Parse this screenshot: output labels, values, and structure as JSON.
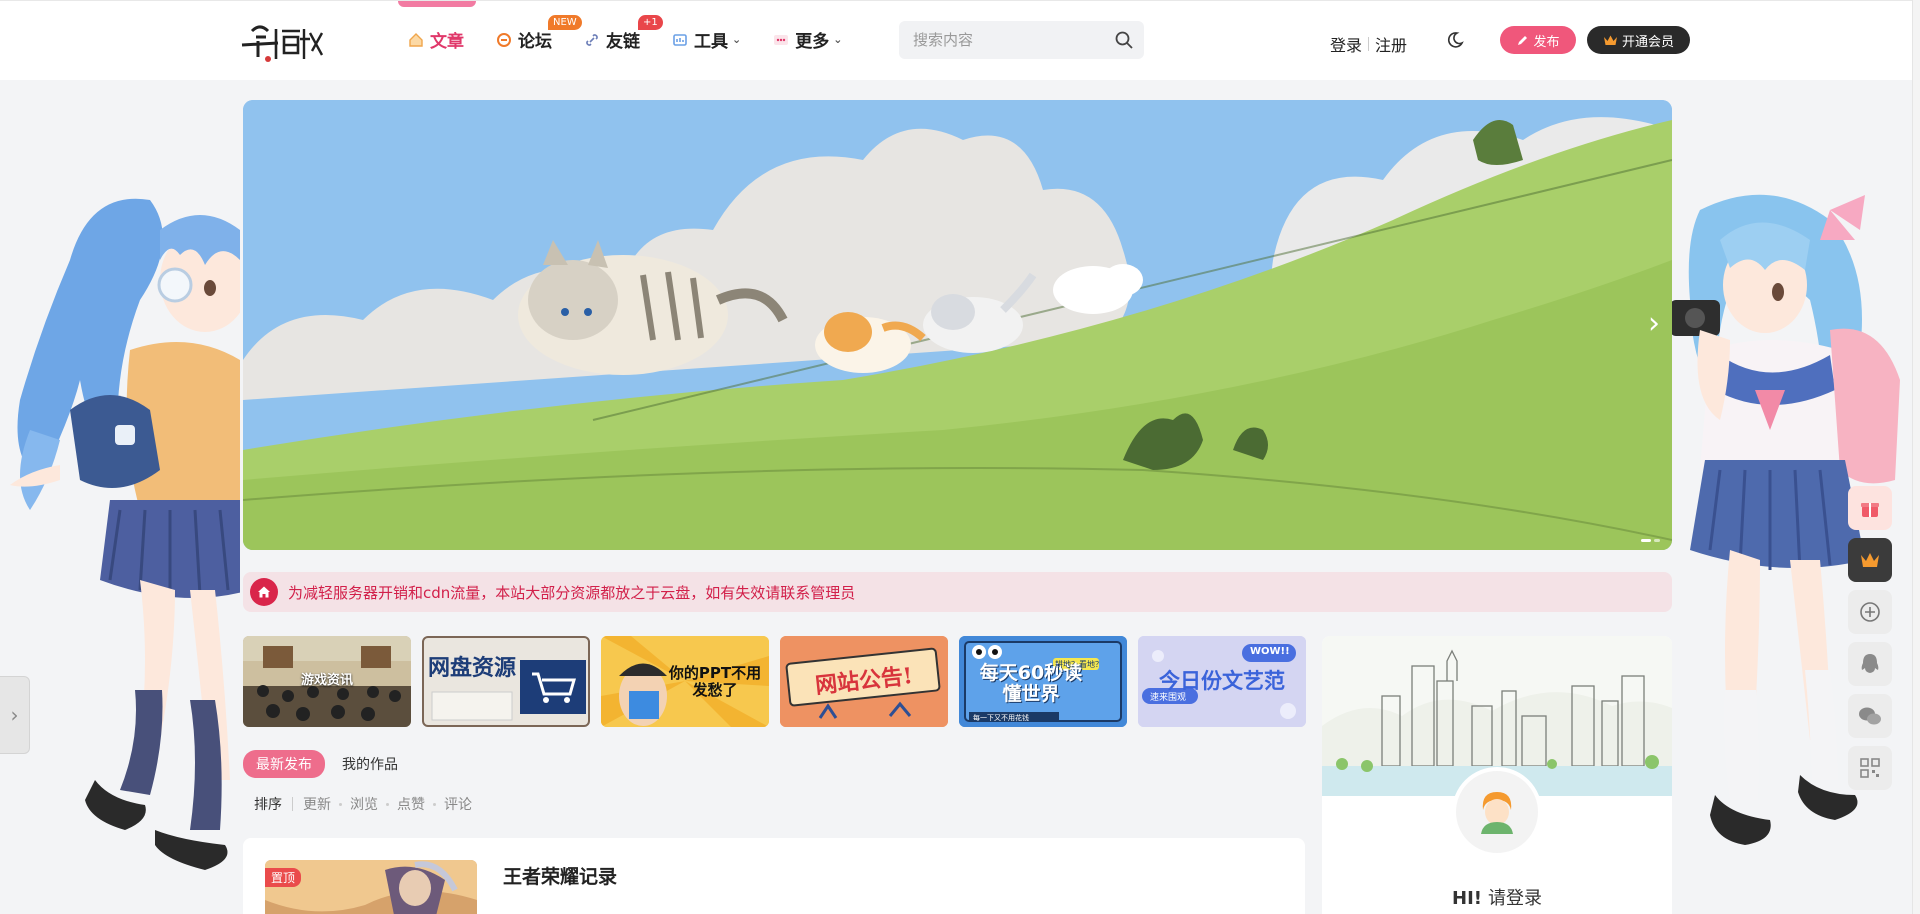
{
  "header": {
    "logo_alt": "一念俩战",
    "nav": [
      {
        "label": "文章",
        "icon": "home-icon",
        "active": true
      },
      {
        "label": "论坛",
        "icon": "forum-icon",
        "badge": "NEW"
      },
      {
        "label": "友链",
        "icon": "link-icon",
        "badge": "+1"
      },
      {
        "label": "工具",
        "icon": "tools-icon"
      },
      {
        "label": "更多",
        "icon": "more-icon"
      }
    ],
    "search_placeholder": "搜索内容",
    "login": "登录",
    "register": "注册",
    "publish": "发布",
    "vip": "开通会员"
  },
  "notice": {
    "text": "为减轻服务器开销和cdn流量，本站大部分资源都放之于云盘，如有失效请联系管理员"
  },
  "categories": [
    {
      "label": "游戏资讯"
    },
    {
      "label": "网盘资源"
    },
    {
      "label": "你的PPT不用发愁了"
    },
    {
      "label": "网站公告!"
    },
    {
      "label": "每天60秒读懂世界"
    },
    {
      "label": "今日份文艺范"
    }
  ],
  "category_subs": {
    "c4_small": "每一下又不用花钱",
    "c4_tag": "耕地？看地？",
    "c5_small": "速来围观",
    "c5_tag": "WOW!!"
  },
  "tabs": [
    "最新发布",
    "我的作品"
  ],
  "sort": {
    "title": "排序",
    "options": [
      "更新",
      "浏览",
      "点赞",
      "评论"
    ]
  },
  "post": {
    "pin": "置顶",
    "title": "王者荣耀记录"
  },
  "user_panel": {
    "greet_prefix": "HI!",
    "greet_action": "请登录"
  },
  "colors": {
    "accent": "#e0386a",
    "publish_btn": "#f0577b",
    "vip_btn": "#2a2a2a",
    "notice_bg": "#f4e2e6",
    "notice_text": "#d2204a"
  }
}
